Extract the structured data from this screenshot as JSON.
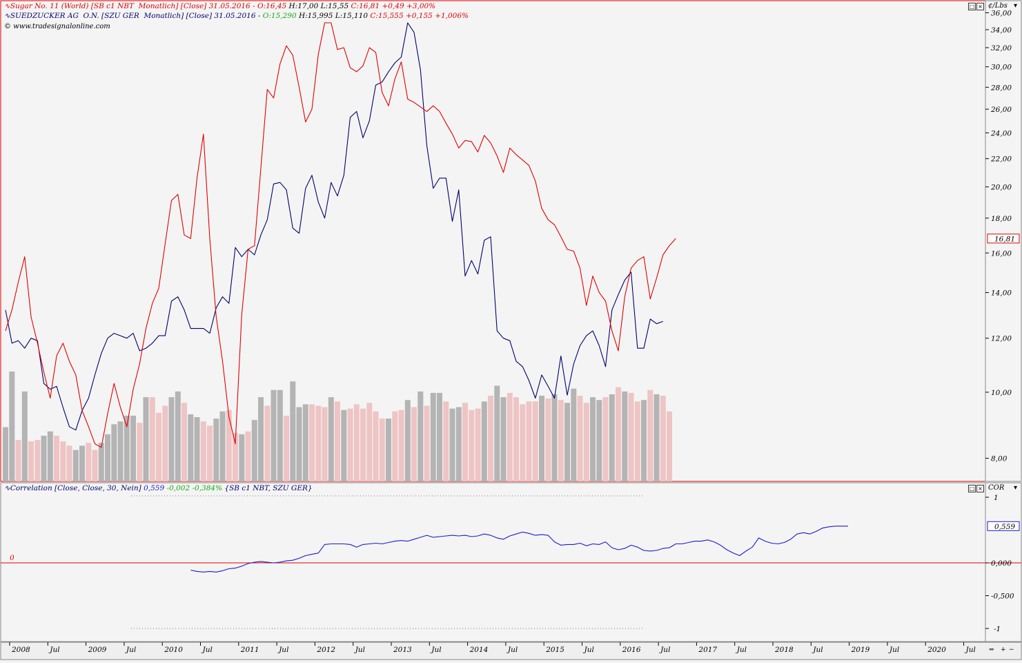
{
  "colors": {
    "sugar": "#e00000",
    "suedzucker": "#00006e",
    "corr": "#1a1ad0",
    "green": "#16a816",
    "vol_up": "#b4b4b4",
    "vol_down": "#eec4c4",
    "panel_bg": "#f4f4f4"
  },
  "legend": {
    "sugar": {
      "label": "Sugar No. 11 (World) [SB c1 NBT  Monatlich] [Close] 31.05.2016 - ",
      "open": "O:16,45 ",
      "hl": "H:17,00 L:15,55 ",
      "close": "C:16,81 +0,49 +3,00%"
    },
    "suedzucker": {
      "label": "SUEDZUCKER AG  O.N. [SZU GER  Monatlich] [Close] 31.05.2016 - ",
      "open": "O:15,290 ",
      "hl": "H:15,995 L:15,110 ",
      "close": "C:15,555 +0,155 +1,006%"
    },
    "copyright": "© www.tradesignalonline.com",
    "correlation": {
      "label": "Correlation [Close, Close, 30, Nein] ",
      "value": "0,559 ",
      "change": "-0,002 -0,384% ",
      "symbols": "{SB c1 NBT, SZU GER}"
    }
  },
  "top_unit_label": "¢/Lbs",
  "bottom_unit_label": "COR",
  "chart_data": [
    {
      "type": "line",
      "scale": "log",
      "ylim": [
        7.4,
        37.5
      ],
      "y_ticks": [
        "36,00",
        "34,00",
        "32,00",
        "30,00",
        "28,00",
        "26,00",
        "24,00",
        "22,00",
        "20,00",
        "18,00",
        "16,00",
        "14,00",
        "12,00",
        "10,00",
        "8,00"
      ],
      "last_value_label": "16,81",
      "x_start": "2008-01",
      "series": [
        {
          "name": "Sugar No. 11 (World)",
          "values": [
            12.3,
            13.2,
            14.5,
            15.8,
            12.9,
            11.8,
            10.7,
            9.8,
            11.3,
            11.8,
            11.1,
            10.6,
            9.4,
            8.9,
            8.4,
            8.3,
            9.3,
            10.3,
            9.5,
            8.9,
            10.1,
            11.0,
            12.4,
            13.5,
            14.2,
            16.5,
            19.1,
            19.5,
            17.0,
            16.8,
            20.6,
            23.9,
            16.8,
            12.9,
            11.1,
            9.2,
            8.4,
            13.0,
            16.2,
            16.4,
            21.3,
            27.8,
            27.0,
            30.3,
            32.2,
            31.2,
            28.0,
            24.9,
            26.0,
            31.3,
            34.8,
            34.8,
            31.8,
            32.0,
            29.9,
            29.5,
            30.1,
            32.0,
            31.5,
            27.5,
            26.3,
            28.8,
            30.5,
            26.9,
            26.6,
            26.2,
            25.8,
            26.3,
            25.8,
            24.8,
            23.9,
            22.8,
            23.4,
            23.3,
            22.5,
            23.8,
            23.2,
            22.2,
            21.0,
            22.8,
            22.3,
            21.9,
            21.5,
            20.4,
            18.6,
            17.9,
            17.6,
            16.9,
            16.2,
            16.1,
            15.2,
            13.4,
            14.8,
            14.0,
            13.6,
            12.3,
            11.5,
            13.8,
            15.2,
            15.6,
            15.8,
            13.7,
            14.7,
            15.9,
            16.4,
            16.8
          ],
          "color": "#e00000"
        },
        {
          "name": "SUEDZUCKER AG  O.N.",
          "values": [
            13.2,
            11.8,
            11.9,
            11.6,
            12.0,
            11.9,
            10.3,
            10.1,
            10.2,
            9.5,
            8.9,
            8.8,
            9.4,
            9.8,
            10.6,
            11.4,
            12.0,
            12.2,
            12.1,
            12.0,
            12.2,
            11.5,
            11.6,
            11.8,
            12.1,
            12.1,
            13.6,
            13.8,
            13.2,
            12.4,
            12.4,
            12.4,
            12.2,
            13.3,
            13.8,
            13.5,
            16.3,
            15.8,
            16.2,
            15.9,
            17.0,
            17.9,
            20.2,
            20.3,
            19.8,
            17.4,
            17.1,
            19.9,
            20.8,
            19.0,
            18.0,
            20.3,
            19.4,
            20.8,
            25.3,
            25.8,
            23.6,
            25.0,
            28.2,
            28.5,
            29.5,
            30.4,
            31.0,
            34.8,
            33.7,
            29.7,
            23.0,
            19.9,
            20.6,
            20.6,
            17.8,
            19.8,
            14.8,
            15.6,
            14.9,
            16.7,
            16.9,
            12.3,
            12.0,
            11.9,
            11.1,
            10.9,
            10.4,
            9.8,
            10.6,
            10.2,
            9.8,
            11.3,
            9.9,
            11.0,
            11.7,
            12.1,
            12.3,
            11.7,
            10.9,
            13.2,
            13.9,
            14.6,
            15.0,
            11.6,
            11.6,
            12.8,
            12.6,
            12.7
          ],
          "color": "#00006e"
        }
      ],
      "volume": [
        [
          0.38,
          0
        ],
        [
          0.77,
          0
        ],
        [
          0.29,
          1
        ],
        [
          0.63,
          0
        ],
        [
          0.28,
          1
        ],
        [
          0.29,
          1
        ],
        [
          0.32,
          0
        ],
        [
          0.35,
          0
        ],
        [
          0.32,
          1
        ],
        [
          0.28,
          1
        ],
        [
          0.25,
          1
        ],
        [
          0.22,
          0
        ],
        [
          0.25,
          0
        ],
        [
          0.27,
          1
        ],
        [
          0.22,
          1
        ],
        [
          0.27,
          0
        ],
        [
          0.33,
          0
        ],
        [
          0.4,
          0
        ],
        [
          0.42,
          0
        ],
        [
          0.46,
          0
        ],
        [
          0.46,
          0
        ],
        [
          0.41,
          1
        ],
        [
          0.59,
          0
        ],
        [
          0.59,
          1
        ],
        [
          0.48,
          1
        ],
        [
          0.53,
          1
        ],
        [
          0.59,
          0
        ],
        [
          0.63,
          0
        ],
        [
          0.55,
          1
        ],
        [
          0.47,
          0
        ],
        [
          0.45,
          0
        ],
        [
          0.42,
          1
        ],
        [
          0.39,
          1
        ],
        [
          0.44,
          0
        ],
        [
          0.49,
          0
        ],
        [
          0.5,
          1
        ],
        [
          0.34,
          1
        ],
        [
          0.33,
          0
        ],
        [
          0.35,
          1
        ],
        [
          0.43,
          0
        ],
        [
          0.59,
          0
        ],
        [
          0.53,
          1
        ],
        [
          0.64,
          0
        ],
        [
          0.64,
          0
        ],
        [
          0.46,
          1
        ],
        [
          0.7,
          0
        ],
        [
          0.52,
          0
        ],
        [
          0.54,
          0
        ],
        [
          0.54,
          1
        ],
        [
          0.53,
          1
        ],
        [
          0.52,
          1
        ],
        [
          0.59,
          0
        ],
        [
          0.56,
          1
        ],
        [
          0.5,
          0
        ],
        [
          0.51,
          1
        ],
        [
          0.54,
          1
        ],
        [
          0.51,
          1
        ],
        [
          0.55,
          1
        ],
        [
          0.49,
          1
        ],
        [
          0.44,
          1
        ],
        [
          0.44,
          0
        ],
        [
          0.49,
          1
        ],
        [
          0.5,
          1
        ],
        [
          0.57,
          0
        ],
        [
          0.52,
          1
        ],
        [
          0.63,
          0
        ],
        [
          0.53,
          1
        ],
        [
          0.62,
          0
        ],
        [
          0.62,
          0
        ],
        [
          0.56,
          1
        ],
        [
          0.51,
          0
        ],
        [
          0.52,
          0
        ],
        [
          0.55,
          1
        ],
        [
          0.5,
          1
        ],
        [
          0.51,
          1
        ],
        [
          0.56,
          0
        ],
        [
          0.6,
          1
        ],
        [
          0.67,
          0
        ],
        [
          0.59,
          0
        ],
        [
          0.62,
          1
        ],
        [
          0.59,
          1
        ],
        [
          0.54,
          1
        ],
        [
          0.56,
          1
        ],
        [
          0.56,
          1
        ],
        [
          0.6,
          0
        ],
        [
          0.58,
          1
        ],
        [
          0.61,
          0
        ],
        [
          0.57,
          1
        ],
        [
          0.55,
          0
        ],
        [
          0.65,
          0
        ],
        [
          0.6,
          1
        ],
        [
          0.55,
          1
        ],
        [
          0.59,
          0
        ],
        [
          0.57,
          0
        ],
        [
          0.59,
          1
        ],
        [
          0.61,
          0
        ],
        [
          0.66,
          1
        ],
        [
          0.63,
          0
        ],
        [
          0.62,
          1
        ],
        [
          0.56,
          1
        ],
        [
          0.57,
          0
        ],
        [
          0.64,
          1
        ],
        [
          0.61,
          0
        ],
        [
          0.6,
          1
        ],
        [
          0.49,
          1
        ]
      ]
    },
    {
      "type": "line",
      "title": "Correlation",
      "ylim": [
        -1.0,
        1.0
      ],
      "y_ticks": [
        "1",
        "0,000",
        "-0,500",
        "-1"
      ],
      "zero_label": "0",
      "last_value_label": "0,559",
      "x_start": "2008-01",
      "start_index": 29,
      "series": [
        {
          "name": "Correlation",
          "values": [
            -0.11,
            -0.13,
            -0.14,
            -0.13,
            -0.14,
            -0.12,
            -0.09,
            -0.08,
            -0.05,
            -0.01,
            0.01,
            0.02,
            0.01,
            0.0,
            0.01,
            0.03,
            0.04,
            0.07,
            0.11,
            0.13,
            0.15,
            0.28,
            0.29,
            0.29,
            0.29,
            0.28,
            0.24,
            0.28,
            0.29,
            0.3,
            0.29,
            0.31,
            0.33,
            0.34,
            0.33,
            0.36,
            0.39,
            0.42,
            0.39,
            0.4,
            0.41,
            0.42,
            0.41,
            0.42,
            0.4,
            0.41,
            0.44,
            0.42,
            0.38,
            0.36,
            0.41,
            0.44,
            0.47,
            0.45,
            0.42,
            0.43,
            0.42,
            0.32,
            0.27,
            0.28,
            0.28,
            0.3,
            0.26,
            0.29,
            0.28,
            0.32,
            0.23,
            0.2,
            0.22,
            0.27,
            0.24,
            0.19,
            0.18,
            0.19,
            0.22,
            0.23,
            0.29,
            0.29,
            0.31,
            0.33,
            0.33,
            0.35,
            0.32,
            0.27,
            0.2,
            0.15,
            0.11,
            0.18,
            0.24,
            0.38,
            0.33,
            0.3,
            0.29,
            0.31,
            0.36,
            0.44,
            0.46,
            0.44,
            0.48,
            0.53,
            0.55,
            0.56,
            0.56,
            0.56
          ],
          "color": "#1a1ad0"
        }
      ]
    }
  ],
  "x_axis": {
    "labels": [
      "2008",
      "Jul",
      "2009",
      "Jul",
      "2010",
      "Jul",
      "2011",
      "Jul",
      "2012",
      "Jul",
      "2013",
      "Jul",
      "2014",
      "Jul",
      "2015",
      "Jul",
      "2016",
      "Jul",
      "2017",
      "Jul",
      "2018",
      "Jul",
      "2019",
      "Jul",
      "2020",
      "Jul"
    ]
  }
}
